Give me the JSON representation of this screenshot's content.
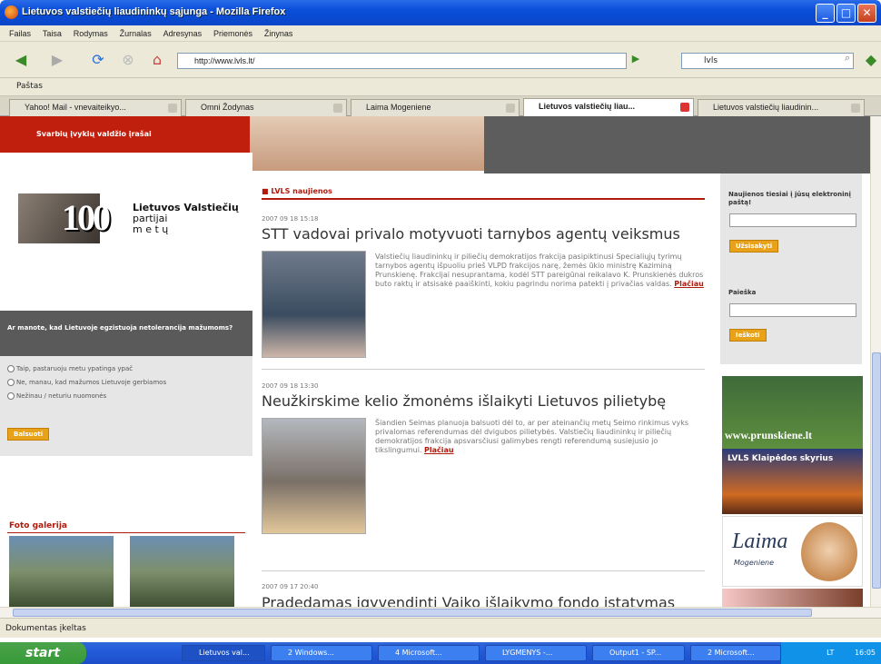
{
  "window": {
    "title": "Lietuvos valstiečių liaudininkų sąjunga - Mozilla Firefox"
  },
  "menu": [
    "Failas",
    "Taisa",
    "Rodymas",
    "Žurnalas",
    "Adresynas",
    "Priemonės",
    "Žinynas"
  ],
  "nav": {
    "url": "http://www.lvls.lt/",
    "search_value": "lvls"
  },
  "bookmarks": {
    "item": "Paštas"
  },
  "tabs": [
    {
      "label": "Yahoo! Mail - vnevaiteikyo..."
    },
    {
      "label": "Omni Žodynas"
    },
    {
      "label": "Laima Mogeniene"
    },
    {
      "label": "Lietuvos valstiečių liau..."
    },
    {
      "label": "Lietuvos valstiečių liaudinin..."
    }
  ],
  "page": {
    "top_bar": "Svarbių įvykių valdžio įrašai",
    "logo": {
      "line1": "Lietuvos Valstiečių",
      "line2": "partijai",
      "line3": "m e t ų",
      "number": "100"
    },
    "poll": {
      "question": "Ar manote, kad Lietuvoje egzistuoja netolerancija mažumoms?",
      "options": [
        "Taip, pastaruoju metu ypatinga ypač",
        "Ne, manau, kad mažumos Lietuvoje gerbiamos",
        "Nežinau / neturiu nuomonės"
      ],
      "vote_button": "Balsuoti"
    },
    "gallery_title": "Foto galerija",
    "news_section": "LVLS naujienos",
    "news": [
      {
        "date": "2007 09 18 15:18",
        "title": "STT vadovai privalo motyvuoti tarnybos agentų veiksmus",
        "text": "Valstiečių liaudininkų ir piliečių demokratijos frakcija pasipiktinusi Specialiųjų tyrimų tarnybos agentų išpuoliu prieš VLPD frakcijos narę, žemės ūkio ministrę Kaziminą Prunskienę. Frakcijai nesuprantama, kodėl STT pareigūnai reikalavo K. Prunskienės dukros buto raktų ir atsisakė paaiškinti, kokiu pagrindu norima patekti į privačias valdas.",
        "more": "Plačiau"
      },
      {
        "date": "2007 09 18 13:30",
        "title": "Neužkirskime kelio žmonėms išlaikyti Lietuvos pilietybę",
        "text": "Šiandien Seimas planuoja balsuoti dėl to, ar per ateinančių metų Seimo rinkimus vyks privalomas referendumas dėl dvigubos pilietybės. Valstiečių liaudininkų ir piliečių demokratijos frakcija apsvarsčiusi galimybes rengti referendumą susiejusio jo tikslingumui.",
        "more": "Plačiau"
      },
      {
        "date": "2007 09 17 20:40",
        "title": "Pradedamas įgyvendinti Vaiko išlaikymo fondo įstatymas"
      }
    ],
    "newsletter": {
      "label": "Naujienos tiesiai į jūsų elektroninį paštą!",
      "button": "Užsisakyti"
    },
    "search": {
      "label": "Paieška",
      "button": "Ieškoti"
    },
    "banners": {
      "prunskiene": "www.prunskiene.lt",
      "klaipeda": "LVLS Klaipėdos skyrius",
      "laima": "Laima",
      "laima_sub": "Mogeniene"
    }
  },
  "status": "Dokumentas įkeltas",
  "taskbar": {
    "start": "start",
    "tasks": [
      "Lietuvos val...",
      "2 Windows...",
      "4 Microsoft...",
      "LYGMENYS -...",
      "Output1 - SP...",
      "2 Microsoft..."
    ],
    "lang": "LT",
    "clock": "16:05"
  }
}
